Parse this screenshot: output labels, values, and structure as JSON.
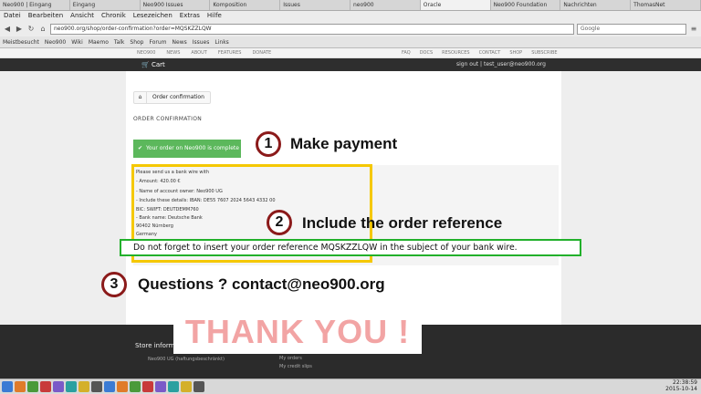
{
  "browser": {
    "tabs": [
      "Neo900 | Eingang",
      "Eingang",
      "Neo900 Issues",
      "Komposition",
      "Issues",
      "neo900",
      "Oracle",
      "Neo900 Foundation",
      "Nachrichten",
      "ThomasNet"
    ],
    "menu": [
      "Datei",
      "Bearbeiten",
      "Ansicht",
      "Chronik",
      "Lesezeichen",
      "Extras",
      "Hilfe"
    ],
    "url": "neo900.org/shop/order-confirmation?order=MQSKZZLQW",
    "search_placeholder": "Google",
    "bookmarks": [
      "Meistbesucht",
      "Neo900",
      "Wiki",
      "Maemo",
      "Talk",
      "Shop",
      "Forum",
      "News",
      "Issues",
      "Links"
    ]
  },
  "site": {
    "topnav_left": [
      "NEO900",
      "NEWS",
      "ABOUT",
      "FEATURES",
      "DONATE"
    ],
    "topnav_right": [
      "FAQ",
      "DOCS",
      "RESOURCES",
      "CONTACT",
      "SHOP",
      "SUBSCRIBE"
    ],
    "cart_label": "Cart",
    "user_label": "sign out | test_user@neo900.org"
  },
  "breadcrumb": {
    "current": "Order confirmation"
  },
  "page_title": "ORDER CONFIRMATION",
  "success_message": "Your order on Neo900 is complete",
  "wire": {
    "intro": "Please send us a bank wire with",
    "lines": [
      "- Amount: 420.00 €",
      "- Name of account owner: Neo900 UG",
      "- Include these details: IBAN: DE55 7607 2024 5643 4332 00",
      "BIC: SWIFT: DEUTDEMM760",
      "- Bank name: Deutsche Bank",
      "90402 Nürnberg",
      "Germany"
    ]
  },
  "steps": [
    {
      "num": "1",
      "text": "Make payment"
    },
    {
      "num": "2",
      "text": "Include the order reference"
    },
    {
      "num": "3",
      "text": "Questions ? contact@neo900.org"
    }
  ],
  "reminder": "Do not forget to insert your order reference MQSKZZLQW in the subject of your bank wire.",
  "footer": {
    "title": "Store information",
    "address": "Neo900 UG (haftungsbeschränkt)",
    "links": [
      "My orders",
      "My credit slips"
    ]
  },
  "thank_you": "THANK YOU !",
  "taskbar": {
    "time": "22:38:59",
    "date": "2015-10-14"
  },
  "colors": {
    "success": "#5cb85c",
    "highlight_yellow": "#f5c800",
    "highlight_green": "#22b02b",
    "badge_ring": "#8b1a1a",
    "thank_you": "#f2a4a4"
  }
}
